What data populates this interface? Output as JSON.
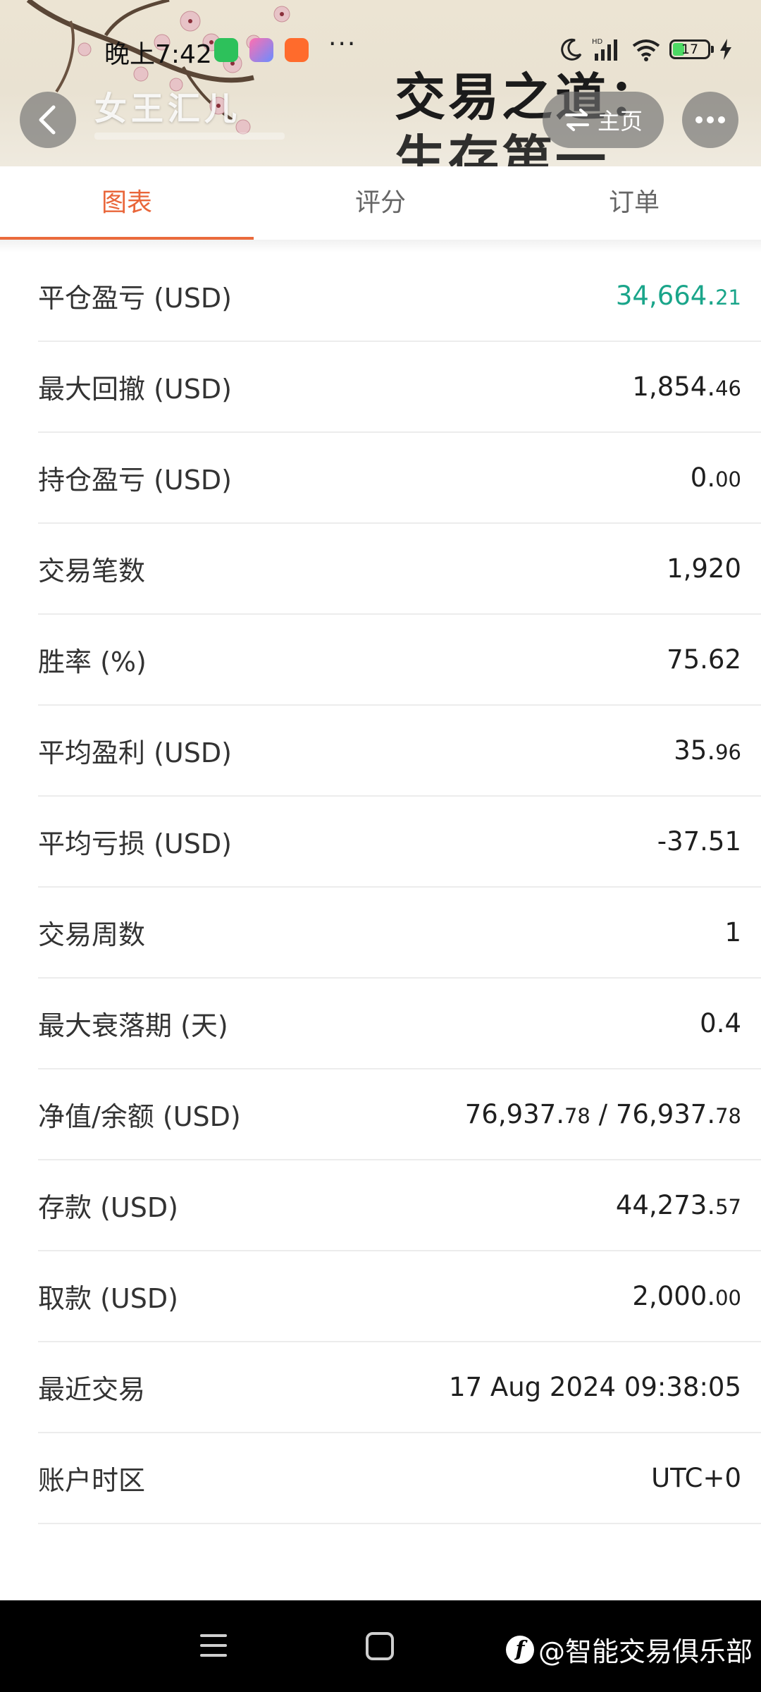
{
  "status_bar": {
    "time": "晚上7:42",
    "more_dots": "···",
    "network_label": "HD",
    "battery": "17"
  },
  "header": {
    "shop_name": "女王汇儿",
    "banner_text_line1": "交易之道：",
    "banner_text_line2": "生存第一",
    "home_label": "主页",
    "back_icon": "chevron-left-icon",
    "more_icon": "more-dots-icon"
  },
  "tabs": [
    {
      "label": "图表",
      "active": true
    },
    {
      "label": "评分",
      "active": false
    },
    {
      "label": "订单",
      "active": false
    }
  ],
  "stats": [
    {
      "label": "平仓盈亏 (USD)",
      "int": "34,664.",
      "dec": "21",
      "positive": true
    },
    {
      "label": "最大回撤 (USD)",
      "int": "1,854.",
      "dec": "46"
    },
    {
      "label": "持仓盈亏 (USD)",
      "int": "0.",
      "dec": "00"
    },
    {
      "label": "交易笔数",
      "int": "1,920",
      "dec": ""
    },
    {
      "label": "胜率 (%)",
      "int": "75.62",
      "dec": ""
    },
    {
      "label": "平均盈利 (USD)",
      "int": "35.",
      "dec": "96"
    },
    {
      "label": "平均亏损 (USD)",
      "int": "-37.51",
      "dec": ""
    },
    {
      "label": "交易周数",
      "int": "1",
      "dec": ""
    },
    {
      "label": "最大衰落期 (天)",
      "int": "0.4",
      "dec": ""
    },
    {
      "label": "净值/余额 (USD)",
      "int": "76,937.",
      "dec": "78",
      "int2": " / 76,937.",
      "dec2": "78"
    },
    {
      "label": "存款 (USD)",
      "int": "44,273.",
      "dec": "57"
    },
    {
      "label": "取款 (USD)",
      "int": "2,000.",
      "dec": "00"
    },
    {
      "label": "最近交易",
      "int": "17 Aug 2024 09:38:05",
      "dec": ""
    },
    {
      "label": "账户时区",
      "int": "UTC+0",
      "dec": ""
    }
  ],
  "watermark": {
    "text": "@智能交易俱乐部",
    "logo": "f"
  },
  "colors": {
    "accent": "#ea6a3c",
    "positive": "#1aa58a"
  }
}
